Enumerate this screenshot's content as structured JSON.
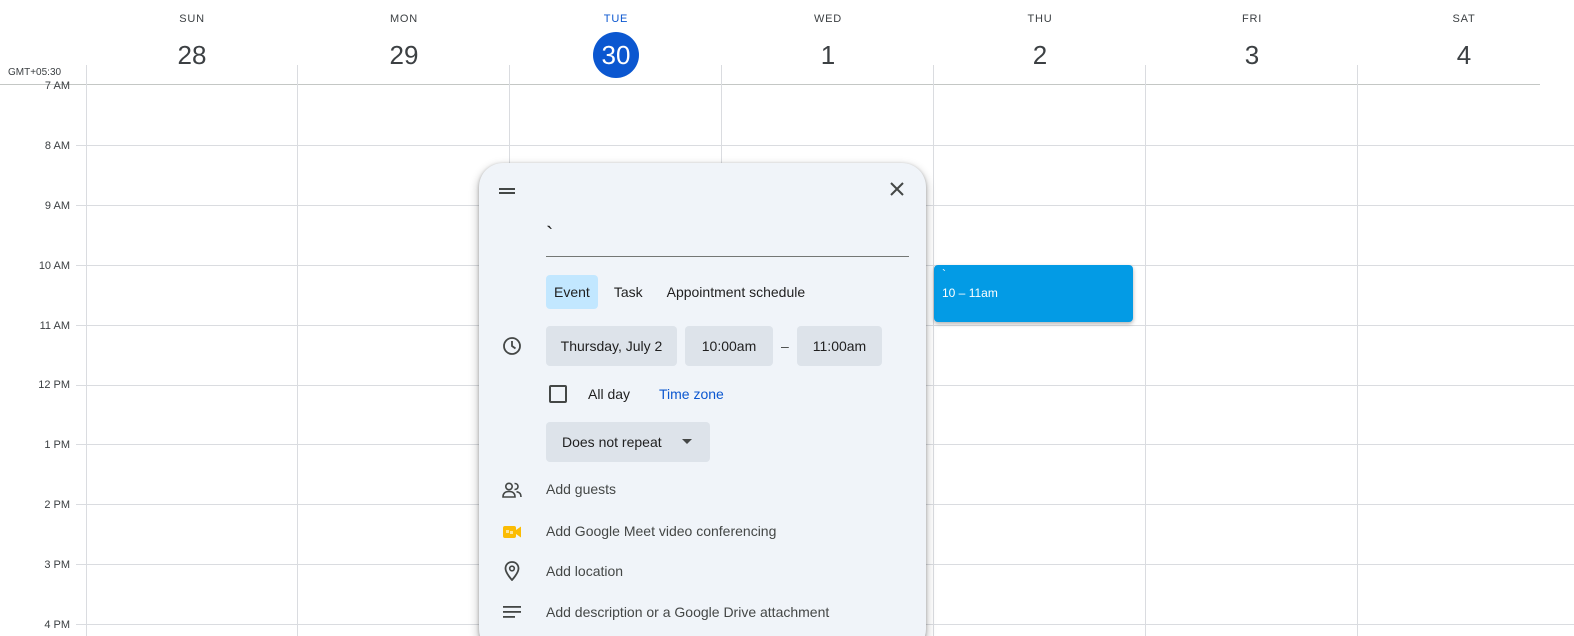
{
  "timezone_label": "GMT+05:30",
  "days": [
    {
      "name": "SUN",
      "num": "28"
    },
    {
      "name": "MON",
      "num": "29"
    },
    {
      "name": "TUE",
      "num": "30"
    },
    {
      "name": "WED",
      "num": "1"
    },
    {
      "name": "THU",
      "num": "2"
    },
    {
      "name": "FRI",
      "num": "3"
    },
    {
      "name": "SAT",
      "num": "4"
    }
  ],
  "hours": [
    "7 AM",
    "8 AM",
    "9 AM",
    "10 AM",
    "11 AM",
    "12 PM",
    "1 PM",
    "2 PM",
    "3 PM",
    "4 PM"
  ],
  "event_chip": {
    "title": "`",
    "time": "10 – 11am"
  },
  "dialog": {
    "title_value": "`",
    "tabs": [
      "Event",
      "Task",
      "Appointment schedule"
    ],
    "date": "Thursday, July 2",
    "start_time": "10:00am",
    "dash": "–",
    "end_time": "11:00am",
    "all_day": "All day",
    "time_zone": "Time zone",
    "repeat": "Does not repeat",
    "add_guests": "Add guests",
    "add_meet": "Add Google Meet video conferencing",
    "add_location": "Add location",
    "add_description": "Add description or a Google Drive attachment"
  },
  "colors": {
    "accent": "#0b57d0",
    "event": "#039be5",
    "meet": "#fbbc04"
  }
}
